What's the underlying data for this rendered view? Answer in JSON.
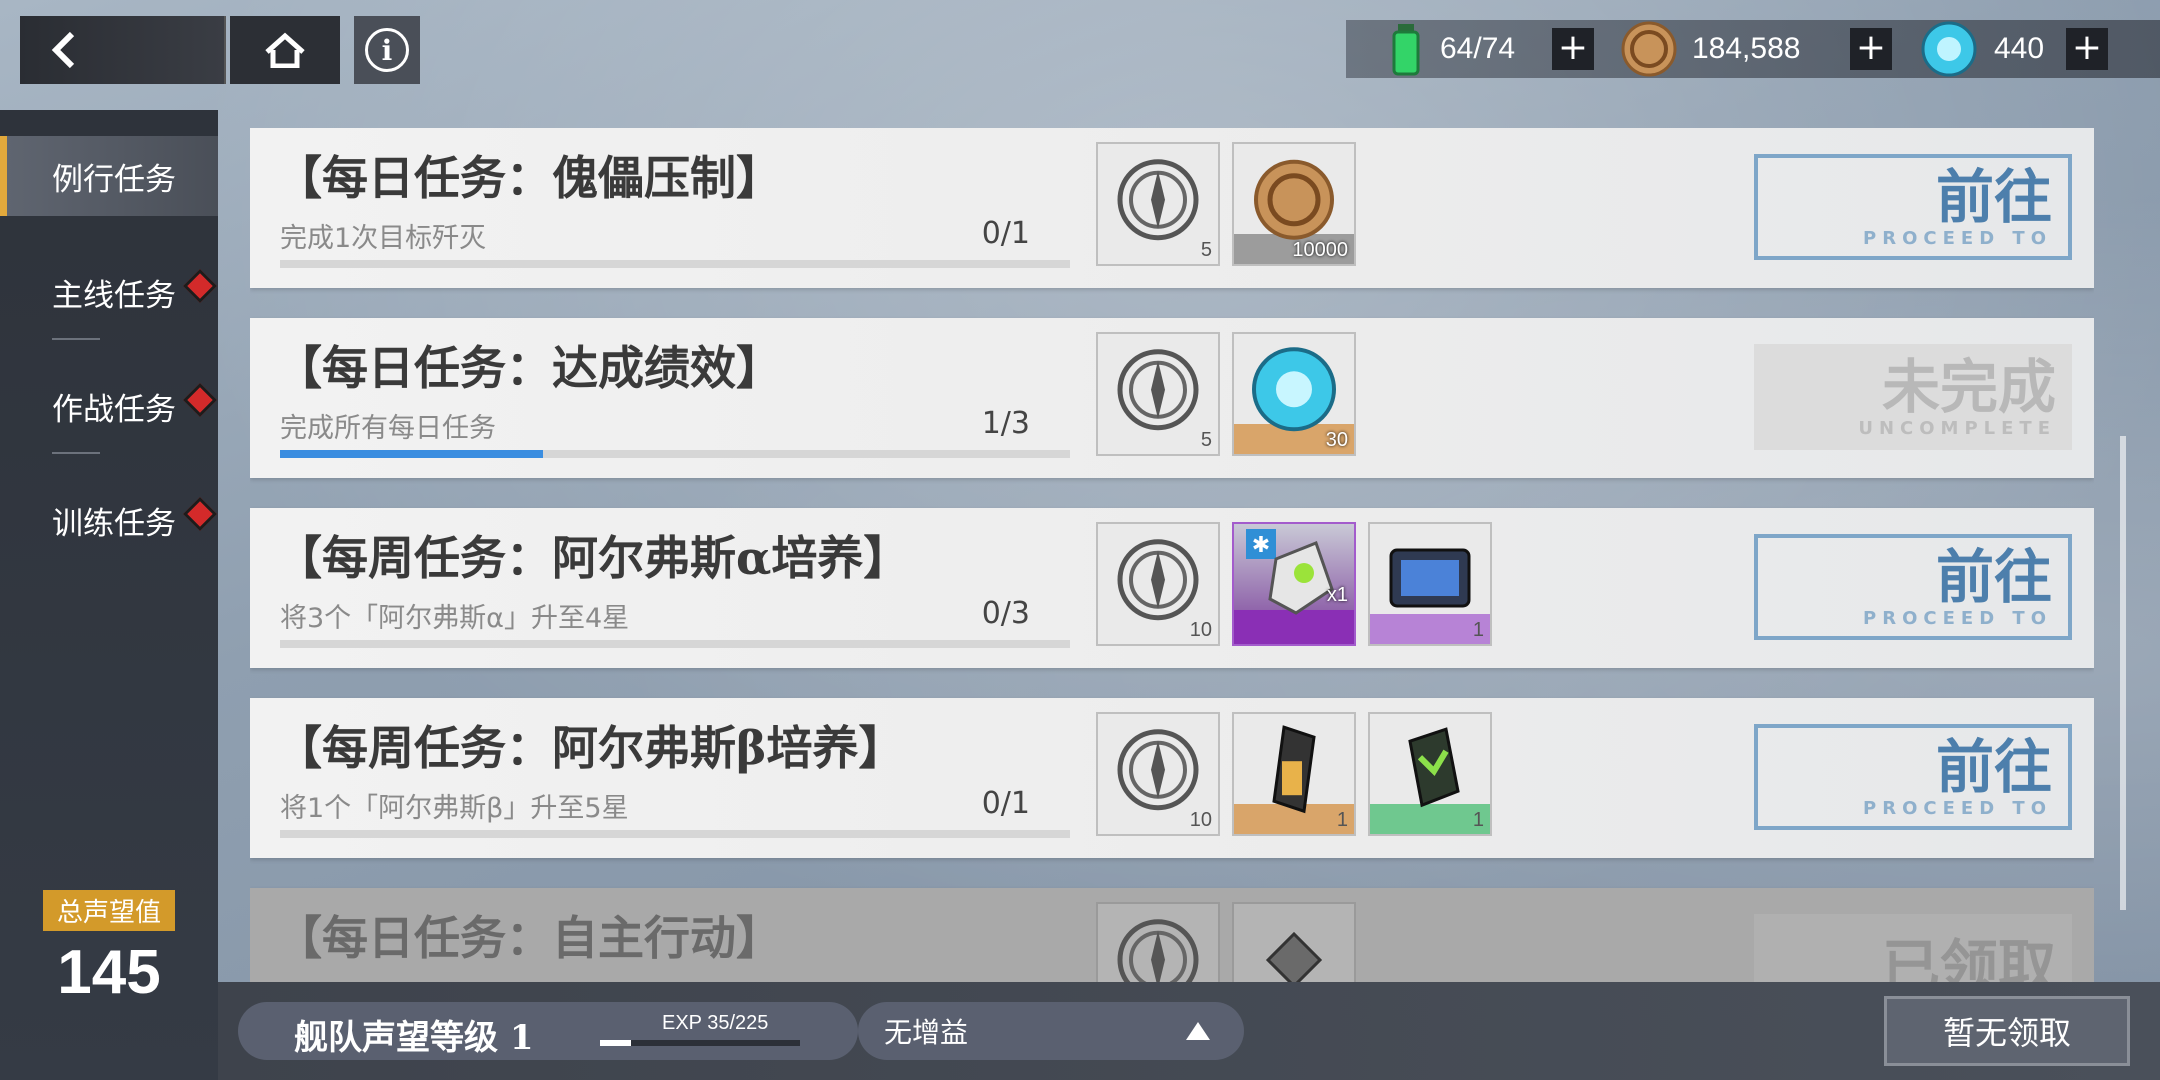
{
  "resources": [
    {
      "icon": "stamina-vial-icon",
      "value": "64/74"
    },
    {
      "icon": "coin-icon",
      "value": "184,588"
    },
    {
      "icon": "crystal-icon",
      "value": "440"
    }
  ],
  "plus_label": "+",
  "sidebar": {
    "items": [
      {
        "label": "例行任务",
        "active": true,
        "badge": false
      },
      {
        "label": "主线任务",
        "active": false,
        "badge": true
      },
      {
        "label": "作战任务",
        "active": false,
        "badge": true
      },
      {
        "label": "训练任务",
        "active": false,
        "badge": true
      }
    ],
    "prestige_label": "总声望值",
    "prestige_value": "145"
  },
  "tasks": [
    {
      "title": "【每日任务：傀儡压制】",
      "desc": "完成1次目标歼灭",
      "progress": "0/1",
      "progress_fraction": 0,
      "rewards": [
        {
          "icon": "prestige-medal-icon",
          "count": "5"
        },
        {
          "icon": "coin-icon",
          "count": "10000"
        }
      ],
      "action_main": "前往",
      "action_sub": "PROCEED TO",
      "action_state": "proceed"
    },
    {
      "title": "【每日任务：达成绩效】",
      "desc": "完成所有每日任务",
      "progress": "1/3",
      "progress_fraction": 0.333,
      "rewards": [
        {
          "icon": "prestige-medal-icon",
          "count": "5"
        },
        {
          "icon": "crystal-icon",
          "count": "30"
        }
      ],
      "action_main": "未完成",
      "action_sub": "UNCOMPLETE",
      "action_state": "incomplete"
    },
    {
      "title": "【每周任务：阿尔弗斯α培养】",
      "desc": "将3个「阿尔弗斯α」升至4星",
      "progress": "0/3",
      "progress_fraction": 0,
      "rewards": [
        {
          "icon": "prestige-medal-icon",
          "count": "10"
        },
        {
          "icon": "character-card-icon",
          "count": "x1"
        },
        {
          "icon": "data-chip-icon",
          "count": "1"
        }
      ],
      "action_main": "前往",
      "action_sub": "PROCEED TO",
      "action_state": "proceed"
    },
    {
      "title": "【每周任务：阿尔弗斯β培养】",
      "desc": "将1个「阿尔弗斯β」升至5星",
      "progress": "0/1",
      "progress_fraction": 0,
      "rewards": [
        {
          "icon": "prestige-medal-icon",
          "count": "10"
        },
        {
          "icon": "component-icon",
          "count": "1"
        },
        {
          "icon": "battery-icon",
          "count": "1"
        }
      ],
      "action_main": "前往",
      "action_sub": "PROCEED TO",
      "action_state": "proceed"
    },
    {
      "title": "【每日任务：自主行动】",
      "desc": "",
      "progress": "",
      "progress_fraction": 0,
      "rewards": [
        {
          "icon": "prestige-medal-icon",
          "count": ""
        },
        {
          "icon": "chip-icon",
          "count": ""
        }
      ],
      "action_main": "已领取",
      "action_sub": "",
      "action_state": "claimed"
    }
  ],
  "bottom": {
    "level_title": "舰队声望等级 1",
    "exp_label": "EXP  35/225",
    "exp_fraction": 0.156,
    "buff_label": "无增益",
    "claim_label": "暂无领取"
  }
}
